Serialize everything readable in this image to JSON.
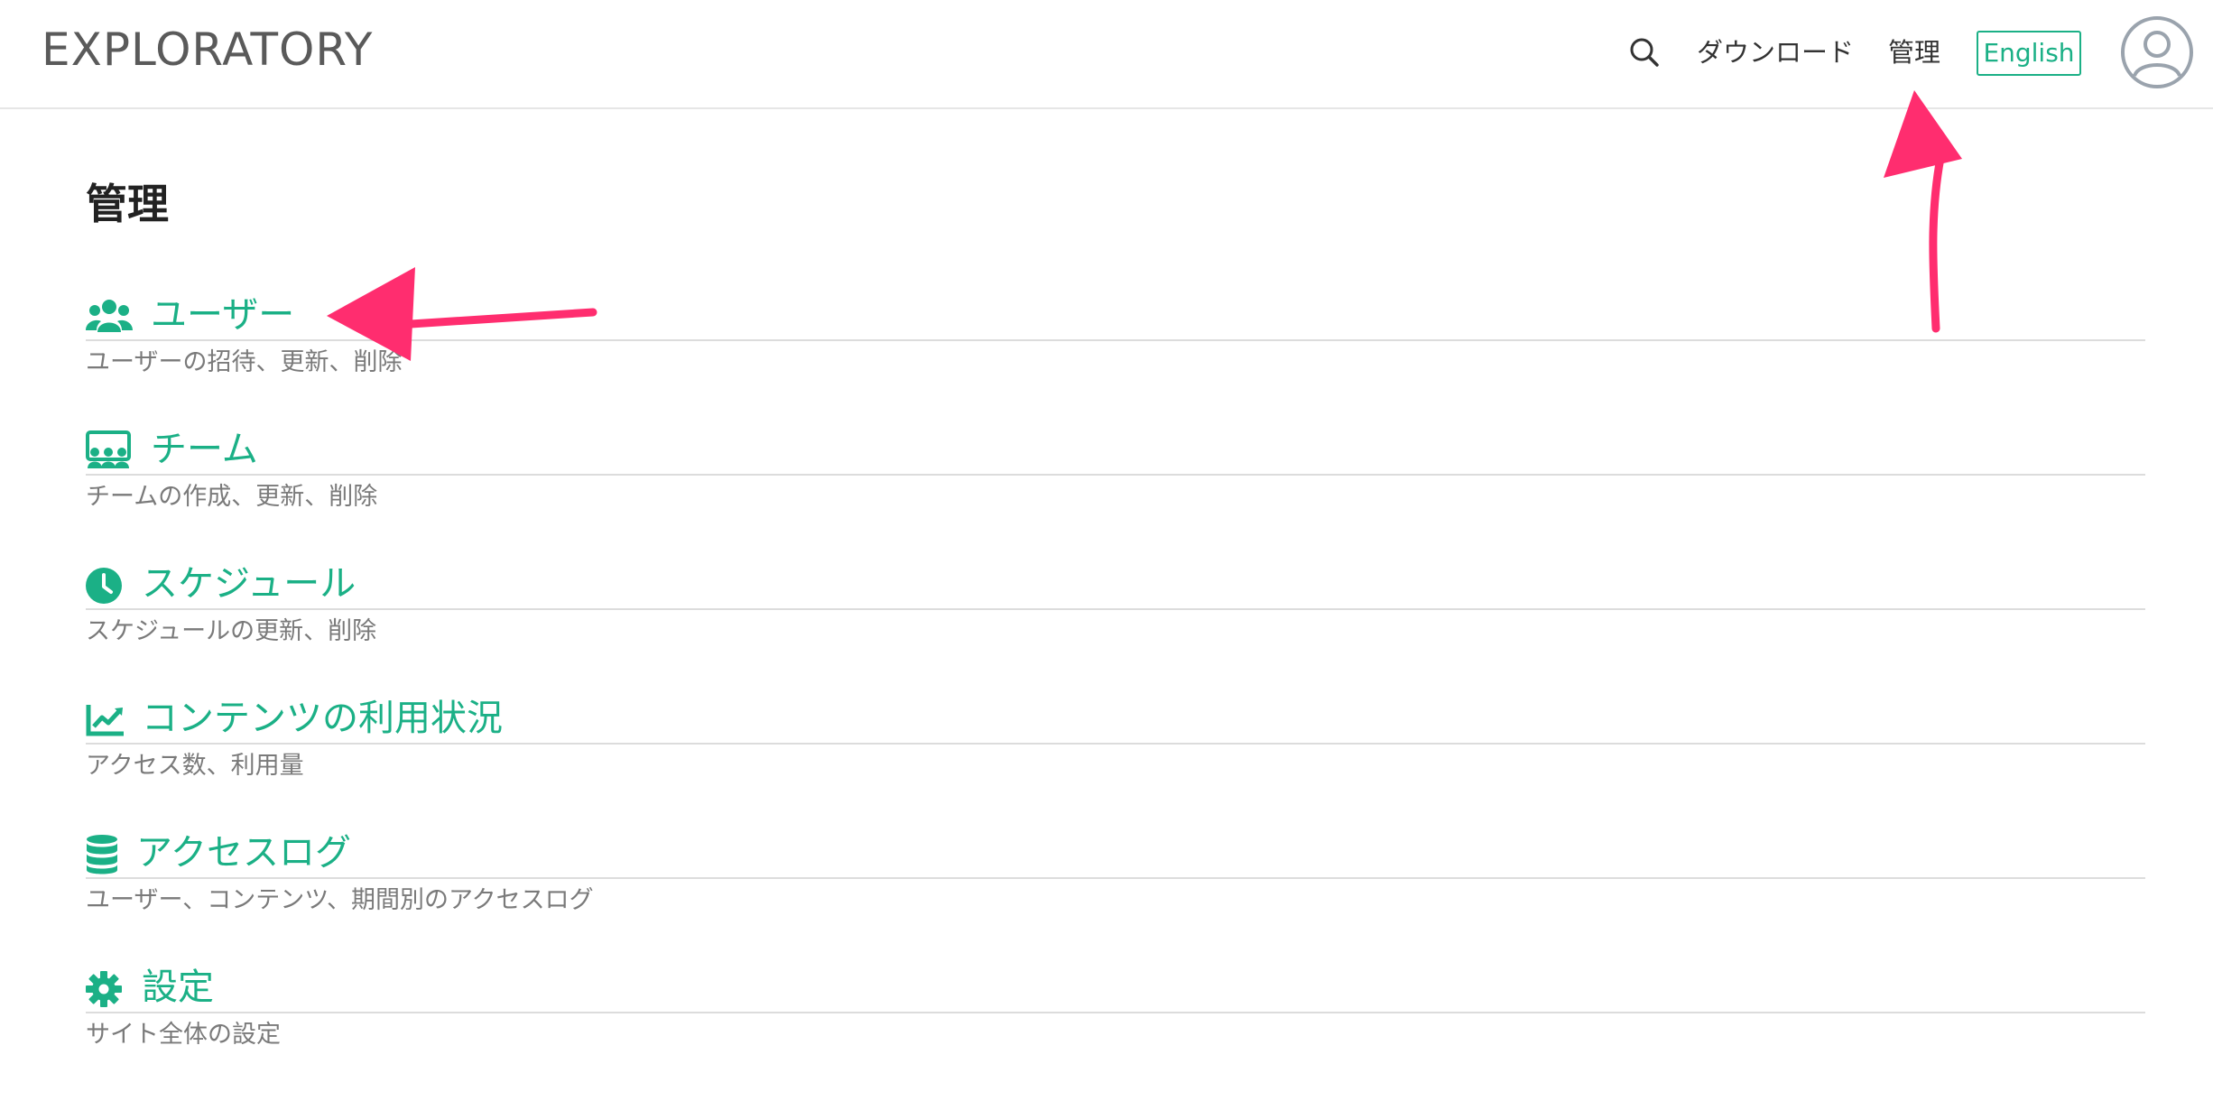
{
  "header": {
    "logo": "EXPLORATORY",
    "search_icon": "search-icon",
    "download_label": "ダウンロード",
    "admin_label": "管理",
    "language_label": "English",
    "avatar_icon": "user-circle-icon",
    "accent_color": "#1bb086"
  },
  "main": {
    "title": "管理",
    "items": [
      {
        "icon": "users-icon",
        "title": "ユーザー",
        "description": "ユーザーの招待、更新、削除"
      },
      {
        "icon": "team-icon",
        "title": "チーム",
        "description": "チームの作成、更新、削除"
      },
      {
        "icon": "clock-icon",
        "title": "スケジュール",
        "description": "スケジュールの更新、削除"
      },
      {
        "icon": "area-chart-icon",
        "title": "コンテンツの利用状況",
        "description": "アクセス数、利用量"
      },
      {
        "icon": "database-icon",
        "title": "アクセスログ",
        "description": "ユーザー、コンテンツ、期間別のアクセスログ"
      },
      {
        "icon": "gear-icon",
        "title": "設定",
        "description": "サイト全体の設定"
      }
    ]
  },
  "annotations": {
    "arrow_color": "#ff2d6f"
  }
}
